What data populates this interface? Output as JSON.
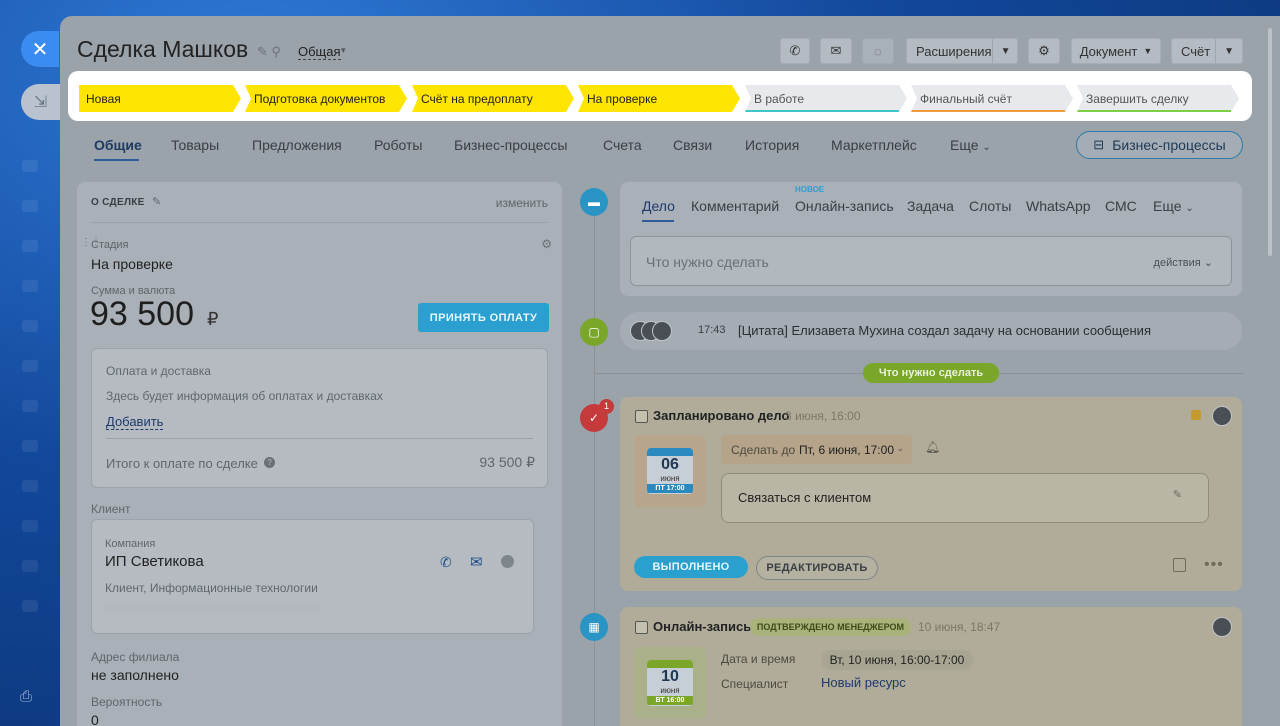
{
  "header": {
    "title": "Сделка Машков",
    "category": "Общая",
    "buttons": {
      "extensions": "Расширения",
      "document": "Документ",
      "invoice": "Счёт"
    }
  },
  "stages": [
    {
      "label": "Новая",
      "state": "done"
    },
    {
      "label": "Подготовка документов",
      "state": "done"
    },
    {
      "label": "Счёт на предоплату",
      "state": "done"
    },
    {
      "label": "На проверке",
      "state": "done"
    },
    {
      "label": "В работе",
      "state": "todo",
      "color": "#3ec6c6"
    },
    {
      "label": "Финальный счёт",
      "state": "todo",
      "color": "#f09a3e"
    },
    {
      "label": "Завершить сделку",
      "state": "todo",
      "color": "#7bd146"
    }
  ],
  "tabs": [
    "Общие",
    "Товары",
    "Предложения",
    "Роботы",
    "Бизнес-процессы",
    "Счета",
    "Связи",
    "История",
    "Маркетплейс",
    "Еще"
  ],
  "bp_button": "Бизнес-процессы",
  "about": {
    "section_title": "О СДЕЛКЕ",
    "edit_link": "изменить",
    "stage_label": "Стадия",
    "stage_value": "На проверке",
    "amount_label": "Сумма и валюта",
    "amount_value": "93 500",
    "currency": "₽",
    "pay_button": "ПРИНЯТЬ ОПЛАТУ",
    "payment": {
      "title": "Оплата и доставка",
      "hint": "Здесь будет информация об оплатах и доставках",
      "add_link": "Добавить",
      "total_label": "Итого к оплате по сделке",
      "total_value": "93 500 ₽"
    },
    "client_label": "Клиент",
    "company_label": "Компания",
    "company_name": "ИП Светикова",
    "company_desc": "Клиент, Информационные технологии",
    "branch_label": "Адрес филиала",
    "branch_value": "не заполнено",
    "probability_label": "Вероятность",
    "probability_value": "0"
  },
  "activity": {
    "new_badge": "НОВОЕ",
    "tabs": [
      "Дело",
      "Комментарий",
      "Онлайн-запись",
      "Задача",
      "Слоты",
      "WhatsApp",
      "СМС",
      "Еще"
    ],
    "input_placeholder": "Что нужно сделать",
    "actions_label": "действия"
  },
  "feed": {
    "comment_time": "17:43",
    "comment_text": "[Цитата] Елизавета Мухина создал задачу на основании сообщения",
    "todo_divider": "Что нужно сделать",
    "task": {
      "badge_count": "1",
      "title": "Запланировано дело",
      "date": "3 июня, 16:00",
      "deadline_label": "Сделать до",
      "deadline_value": "Пт, 6 июня, 17:00",
      "cal_day": "06",
      "cal_month": "июня",
      "cal_foot": "ПТ 17:00",
      "text": "Связаться с клиентом",
      "done_button": "ВЫПОЛНЕНО",
      "edit_button": "РЕДАКТИРОВАТЬ"
    },
    "booking": {
      "title": "Онлайн-запись",
      "status": "ПОДТВЕРЖДЕНО МЕНЕДЖЕРОМ",
      "date": "10 июня, 18:47",
      "cal_day": "10",
      "cal_month": "июня",
      "cal_foot": "ВТ 16:00",
      "datetime_label": "Дата и время",
      "datetime_value": "Вт, 10 июня, 16:00-17:00",
      "specialist_label": "Специалист",
      "specialist_value": "Новый ресурс"
    }
  },
  "colors": {
    "accent": "#2ba0d0",
    "stage_done": "#ffe500",
    "success": "#8dc63f"
  }
}
